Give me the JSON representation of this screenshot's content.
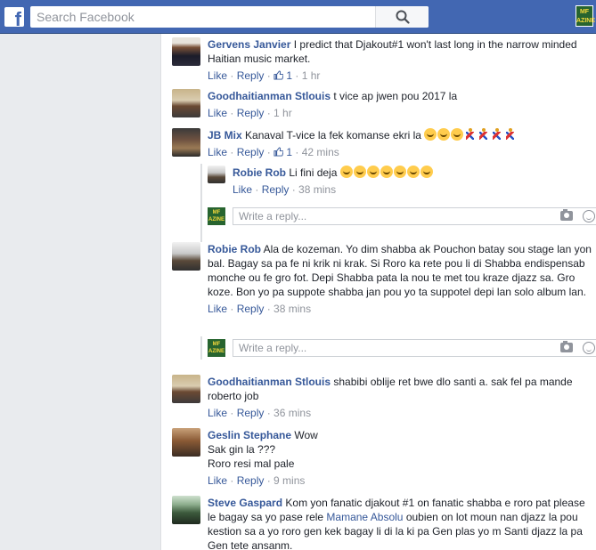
{
  "search": {
    "placeholder": "Search Facebook"
  },
  "logo": {
    "glyph": "f"
  },
  "corner_avatar": {
    "label": "MF AZINE"
  },
  "actions": {
    "like": "Like",
    "reply": "Reply",
    "sep": " · "
  },
  "write_reply": {
    "placeholder": "Write a reply..."
  },
  "comments": [
    {
      "author": "Gervens Janvier",
      "text": "I predict that Djakout#1 won't last long in the narrow minded Haitian music market.",
      "likes": "1",
      "time": "1 hr"
    },
    {
      "author": "Goodhaitianman Stlouis",
      "text": "t vice ap jwen pou 2017 la",
      "time": "1 hr"
    },
    {
      "author": "JB Mix",
      "text": "Kanaval T-vice la fek komanse ekri la",
      "likes": "1",
      "time": "42 mins"
    },
    {
      "author": "Robie Rob",
      "text": "Li fini deja",
      "time": "38 mins"
    },
    {
      "author": "Robie Rob",
      "text": "Ala de kozeman. Yo dim shabba ak Pouchon batay sou stage lan yon bal. Bagay sa pa fe ni krik ni krak. Si Roro ka rete pou li di Shabba endispensab monche ou fe gro fot. Depi Shabba pata la nou te met tou kraze djazz sa. Gro koze. Bon yo pa suppote shabba jan pou yo ta suppotel depi lan solo album lan.",
      "time": "38 mins"
    },
    {
      "author": "Goodhaitianman Stlouis",
      "text": "shabibi oblije ret bwe dlo santi a. sak fel pa mande roberto job",
      "time": "36 mins"
    },
    {
      "author": "Geslin Stephane",
      "line1": "Wow",
      "line2": "Sak gin la ???",
      "line3": "Roro resi mal pale",
      "time": "9 mins"
    },
    {
      "author": "Steve Gaspard",
      "text_before": "Kom yon fanatic djakout #1 on fanatic shabba e roro pat please le bagay sa yo pase rele ",
      "mention": "Mamane Absolu",
      "text_after": " oubien on lot moun nan djazz la pou kestion sa a yo roro gen kek bagay li di la ki pa Gen plas yo m Santi djazz la pa Gen tete ansanm."
    }
  ]
}
